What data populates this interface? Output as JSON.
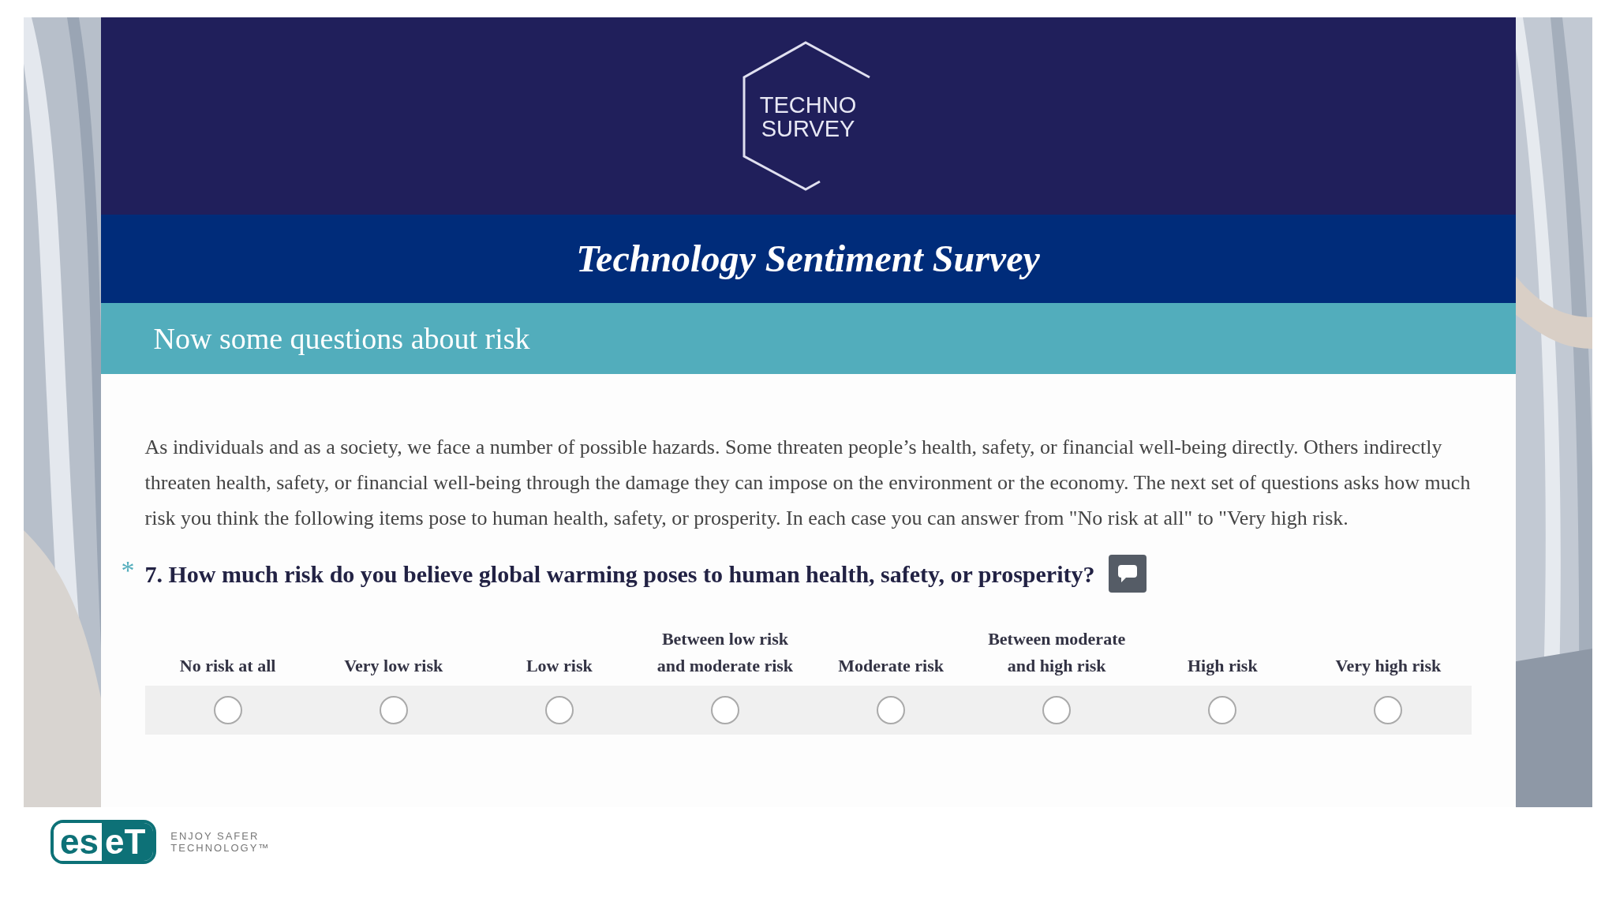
{
  "logo": {
    "lines": [
      "TECHNO",
      "SURVEY"
    ]
  },
  "survey_title": "Technology Sentiment Survey",
  "section_title": "Now some questions about risk",
  "intro": "As individuals and as a society, we face a number of possible hazards. Some threaten people’s health, safety, or financial well-being directly. Others indirectly threaten health, safety, or financial well-being through the damage they can impose on the environment or the economy. The next set of questions asks how much risk you think the following items pose to human health, safety, or prosperity. In each case you can answer from \"No risk at all\" to \"Very high risk.",
  "question": {
    "required_mark": "*",
    "text": "7. How much risk do you believe global warming poses to human health, safety, or prosperity?",
    "options": [
      {
        "label": "No risk at all",
        "selected": false
      },
      {
        "label": "Very low risk",
        "selected": false
      },
      {
        "label": "Low risk",
        "selected": false
      },
      {
        "label": "Between low risk and moderate risk",
        "selected": false
      },
      {
        "label": "Moderate risk",
        "selected": false
      },
      {
        "label": "Between moderate and high risk",
        "selected": false
      },
      {
        "label": "High risk",
        "selected": false
      },
      {
        "label": "Very high risk",
        "selected": false
      }
    ]
  },
  "footer": {
    "brand_left": "es",
    "brand_right": "eT",
    "tagline": [
      "ENJOY SAFER",
      "TECHNOLOGY™"
    ]
  }
}
